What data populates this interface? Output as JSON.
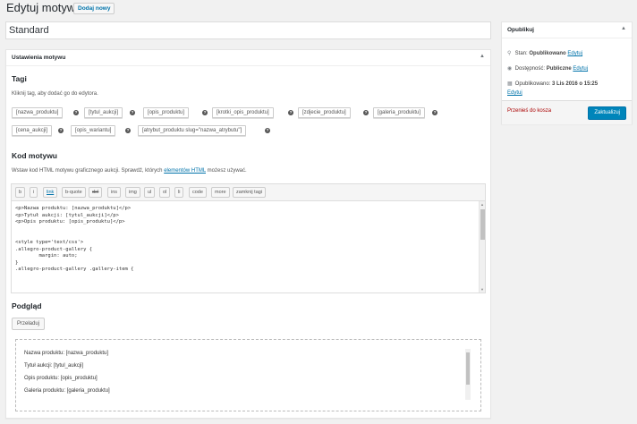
{
  "header": {
    "title": "Edytuj motyw",
    "add_new": "Dodaj nowy"
  },
  "title_field": {
    "value": "Standard"
  },
  "settings": {
    "heading": "Ustawienia motywu",
    "toggle": "▲",
    "tags": {
      "heading": "Tagi",
      "hint": "Kliknij tag, aby dodać go do edytora.",
      "items": [
        "[nazwa_produktu]",
        "[tytul_aukcji]",
        "[opis_produktu]",
        "[krotki_opis_produktu]",
        "[zdjecie_produktu]",
        "[galeria_produktu]",
        "[cena_aukcji]",
        "[opis_wariantu]",
        "[atrybut_produktu slug=\"nazwa_atrybutu\"]"
      ],
      "help_icon": "?"
    },
    "code": {
      "heading": "Kod motywu",
      "desc_pre": "Wstaw kod HTML motywu graficznego aukcji. Sprawdź, których",
      "desc_link": "elementów HTML",
      "desc_post": "możesz używać.",
      "buttons": [
        "b",
        "i",
        "link",
        "b-quote",
        "del",
        "ins",
        "img",
        "ul",
        "ol",
        "li",
        "code",
        "more",
        "zamknij tagi"
      ],
      "lines": [
        "<p>Nazwa produktu: [nazwa_produktu]</p>",
        "<p>Tytuł aukcji: [tytul_aukcji]</p>",
        "<p>Opis produktu: [opis_produktu]</p>",
        "",
        "",
        "<style type='text/css'>",
        ".allegro-product-gallery {",
        "        margin: auto;",
        "}",
        ".allegro-product-gallery .gallery-item {"
      ]
    },
    "preview": {
      "heading": "Podgląd",
      "refresh": "Przeładuj",
      "lines": [
        "Nazwa produktu: [nazwa_produktu]",
        "Tytuł aukcji: [tytul_aukcji]",
        "Opis produktu: [opis_produktu]",
        "Galeria produktu: [galeria_produktu]"
      ]
    }
  },
  "publish": {
    "heading": "Opublikuj",
    "toggle": "▲",
    "status_label": "Stan:",
    "status_value": "Opublikowano",
    "visibility_label": "Dostępność:",
    "visibility_value": "Publiczne",
    "published_label": "Opublikowano:",
    "published_value": "3 Lis 2016 o 15:25",
    "edit": "Edytuj",
    "trash": "Przenieś do kosza",
    "update": "Zaktualizuj"
  }
}
